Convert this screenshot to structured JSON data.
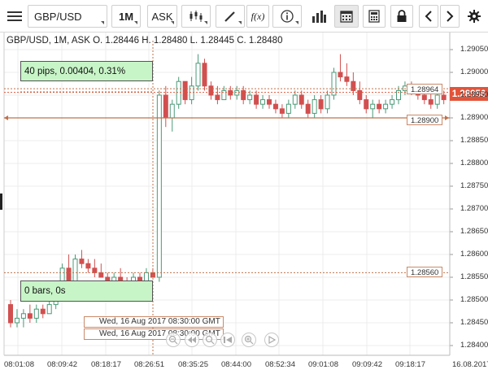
{
  "toolbar": {
    "symbol": "GBP/USD",
    "period": "1M",
    "side": "ASK"
  },
  "chart": {
    "info": "GBP/USD, 1M, ASK   O. 1.28446 H. 1.28480 L. 1.28445 C. 1.28480",
    "measure_pips": "40 pips, 0.00404, 0.31%",
    "measure_bars": "0 bars, 0s",
    "date_1": "Wed, 16 Aug 2017 08:30:00 GMT",
    "date_2": "Wed, 16 Aug 2017 08:30:00 GMT",
    "level_upper": "1.28964",
    "level_mid": "1.28900",
    "level_lower": "1.28560",
    "current_price": "1.28956",
    "price_labels": [
      "1.29050",
      "1.29000",
      "1.28950",
      "1.28900",
      "1.28850",
      "1.28800",
      "1.28750",
      "1.28700",
      "1.28650",
      "1.28600",
      "1.28550",
      "1.28500",
      "1.28450",
      "1.28400"
    ],
    "time_labels": [
      "08:01:08",
      "08:09:42",
      "08:18:17",
      "08:26:51",
      "08:35:25",
      "08:44:00",
      "08:52:34",
      "09:01:08",
      "09:09:42",
      "09:18:17",
      "16.08.2017"
    ],
    "colors": {
      "up": "#4a9a78",
      "down": "#d24f4f",
      "level": "#c0704a",
      "current": "#e2543a",
      "measure_box": "#c8f5c8"
    }
  },
  "chart_data": {
    "type": "candlestick",
    "title": "GBP/USD, 1M, ASK",
    "ohlc_last": {
      "open": 1.28446,
      "high": 1.2848,
      "low": 1.28445,
      "close": 1.2848
    },
    "ylim": [
      1.2838,
      1.29075
    ],
    "y_ticks": [
      1.2905,
      1.29,
      1.2895,
      1.289,
      1.2885,
      1.288,
      1.2875,
      1.287,
      1.2865,
      1.286,
      1.2855,
      1.285,
      1.2845,
      1.284
    ],
    "x_ticks": [
      "08:01:08",
      "08:09:42",
      "08:18:17",
      "08:26:51",
      "08:35:25",
      "08:44:00",
      "08:52:34",
      "09:01:08",
      "09:09:42",
      "09:18:17"
    ],
    "candles": [
      [
        1.2849,
        1.285,
        1.2844,
        1.2845
      ],
      [
        1.2845,
        1.2848,
        1.2844,
        1.2846
      ],
      [
        1.2846,
        1.2848,
        1.2844,
        1.2847
      ],
      [
        1.2847,
        1.2849,
        1.2845,
        1.2846
      ],
      [
        1.2846,
        1.2849,
        1.2845,
        1.2848
      ],
      [
        1.2848,
        1.2849,
        1.2846,
        1.2847
      ],
      [
        1.2847,
        1.285,
        1.2847,
        1.2849
      ],
      [
        1.2849,
        1.2853,
        1.2848,
        1.2852
      ],
      [
        1.2852,
        1.2858,
        1.2851,
        1.2857
      ],
      [
        1.2857,
        1.286,
        1.2853,
        1.2854
      ],
      [
        1.2854,
        1.286,
        1.2853,
        1.2859
      ],
      [
        1.2859,
        1.2861,
        1.2857,
        1.2858
      ],
      [
        1.2858,
        1.2859,
        1.2856,
        1.2857
      ],
      [
        1.2857,
        1.2859,
        1.2855,
        1.2856
      ],
      [
        1.2856,
        1.2858,
        1.2855,
        1.2855
      ],
      [
        1.2855,
        1.2856,
        1.2853,
        1.2854
      ],
      [
        1.2854,
        1.2856,
        1.2853,
        1.2855
      ],
      [
        1.2855,
        1.2857,
        1.2854,
        1.2854
      ],
      [
        1.2854,
        1.2855,
        1.2853,
        1.2853
      ],
      [
        1.2853,
        1.2856,
        1.2852,
        1.2855
      ],
      [
        1.2855,
        1.2856,
        1.2853,
        1.2854
      ],
      [
        1.2854,
        1.2857,
        1.2853,
        1.2856
      ],
      [
        1.2856,
        1.2857,
        1.2855,
        1.2855
      ],
      [
        1.2855,
        1.2896,
        1.2854,
        1.2895
      ],
      [
        1.2895,
        1.2897,
        1.2888,
        1.289
      ],
      [
        1.289,
        1.2894,
        1.2887,
        1.2893
      ],
      [
        1.2893,
        1.2899,
        1.2892,
        1.2898
      ],
      [
        1.2898,
        1.2898,
        1.2893,
        1.2894
      ],
      [
        1.2894,
        1.2899,
        1.2893,
        1.2897
      ],
      [
        1.2897,
        1.2904,
        1.2896,
        1.2902
      ],
      [
        1.2902,
        1.2903,
        1.2896,
        1.2897
      ],
      [
        1.2897,
        1.2898,
        1.2894,
        1.2895
      ],
      [
        1.2895,
        1.2897,
        1.2893,
        1.2894
      ],
      [
        1.2894,
        1.2897,
        1.2894,
        1.2896
      ],
      [
        1.2896,
        1.2897,
        1.2894,
        1.2895
      ],
      [
        1.2895,
        1.2897,
        1.2894,
        1.2896
      ],
      [
        1.2896,
        1.2897,
        1.2893,
        1.2894
      ],
      [
        1.2894,
        1.2896,
        1.2893,
        1.2895
      ],
      [
        1.2895,
        1.2896,
        1.2892,
        1.2893
      ],
      [
        1.2893,
        1.2895,
        1.2892,
        1.2894
      ],
      [
        1.2894,
        1.2895,
        1.2892,
        1.2893
      ],
      [
        1.2893,
        1.2894,
        1.2891,
        1.2892
      ],
      [
        1.2892,
        1.2893,
        1.289,
        1.2891
      ],
      [
        1.2891,
        1.2894,
        1.289,
        1.2893
      ],
      [
        1.2893,
        1.2896,
        1.2892,
        1.2895
      ],
      [
        1.2895,
        1.2896,
        1.2892,
        1.2893
      ],
      [
        1.2893,
        1.2894,
        1.289,
        1.2891
      ],
      [
        1.2891,
        1.2895,
        1.289,
        1.2894
      ],
      [
        1.2894,
        1.2895,
        1.2891,
        1.2892
      ],
      [
        1.2892,
        1.2896,
        1.2891,
        1.2895
      ],
      [
        1.2895,
        1.2901,
        1.2894,
        1.29
      ],
      [
        1.29,
        1.2904,
        1.2898,
        1.2899
      ],
      [
        1.2899,
        1.2902,
        1.2897,
        1.2898
      ],
      [
        1.2898,
        1.29,
        1.2895,
        1.2896
      ],
      [
        1.2896,
        1.2898,
        1.2893,
        1.2894
      ],
      [
        1.2894,
        1.2895,
        1.2891,
        1.2892
      ],
      [
        1.2892,
        1.2894,
        1.289,
        1.2893
      ],
      [
        1.2893,
        1.2894,
        1.2891,
        1.2892
      ],
      [
        1.2892,
        1.2894,
        1.2891,
        1.2893
      ],
      [
        1.2893,
        1.2895,
        1.2892,
        1.2894
      ],
      [
        1.2894,
        1.2897,
        1.2893,
        1.2896
      ],
      [
        1.2896,
        1.2898,
        1.2895,
        1.2897
      ],
      [
        1.2897,
        1.2898,
        1.2895,
        1.2896
      ],
      [
        1.2896,
        1.2897,
        1.2894,
        1.2895
      ],
      [
        1.2895,
        1.2896,
        1.2893,
        1.2894
      ],
      [
        1.2894,
        1.2896,
        1.2892,
        1.2893
      ],
      [
        1.2893,
        1.2896,
        1.2892,
        1.2895
      ],
      [
        1.2895,
        1.2896,
        1.2893,
        1.2894
      ]
    ]
  }
}
